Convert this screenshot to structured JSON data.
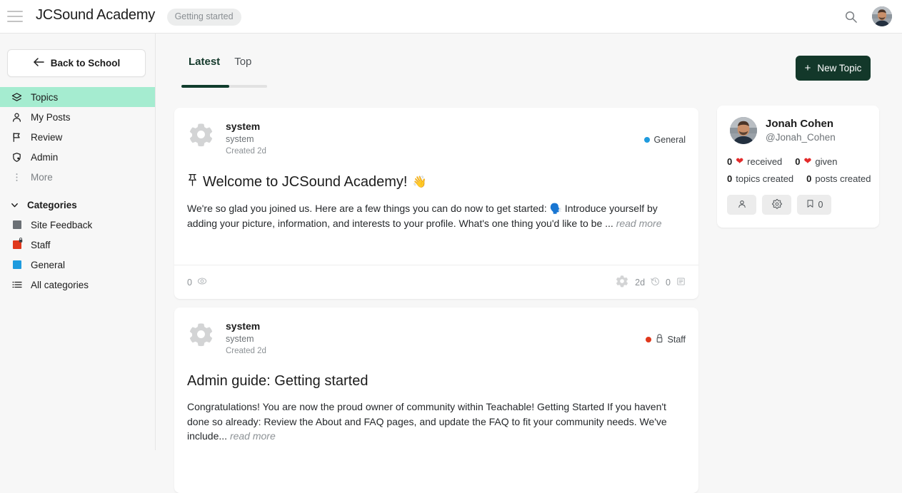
{
  "header": {
    "menu_icon": "hamburger-icon",
    "title": "JCSound Academy",
    "badge": "Getting started",
    "search_icon": "search-icon",
    "avatar_icon": "user-avatar"
  },
  "sidebar": {
    "back_button": "Back to School",
    "back_icon": "arrow-left-icon",
    "nav": [
      {
        "label": "Topics",
        "icon": "layers-icon",
        "active": true
      },
      {
        "label": "My Posts",
        "icon": "person-icon",
        "active": false
      },
      {
        "label": "Review",
        "icon": "flag-icon",
        "active": false
      },
      {
        "label": "Admin",
        "icon": "shield-icon",
        "active": false
      },
      {
        "label": "More",
        "icon": "dots-vertical-icon",
        "active": false
      }
    ],
    "categories_header": "Categories",
    "categories_chevron": "chevron-down-icon",
    "categories": [
      {
        "label": "Site Feedback",
        "color": "#6b7075",
        "locked": false
      },
      {
        "label": "Staff",
        "color": "#e0381c",
        "locked": true
      },
      {
        "label": "General",
        "color": "#1f9bde",
        "locked": false
      },
      {
        "label": "All categories",
        "color": "",
        "locked": false,
        "icon": "list-icon"
      }
    ]
  },
  "main": {
    "tabs": [
      {
        "label": "Latest",
        "active": true
      },
      {
        "label": "Top",
        "active": false
      }
    ],
    "new_topic_button": "New Topic",
    "new_topic_plus": "+",
    "topics": [
      {
        "author": "system",
        "author_sub": "system",
        "created": "Created 2d",
        "category": "General",
        "category_color": "#1f9bde",
        "locked": false,
        "pinned": true,
        "pin_icon": "pin-icon",
        "title": "Welcome to JCSound Academy!",
        "title_emoji": "👋",
        "excerpt": "We're so glad you joined us. Here are a few things you can do now to get started: 🗣️ Introduce yourself by adding your picture, information, and interests to your profile. What's one thing you'd like to be ...",
        "read_more": "read more",
        "views": "0",
        "views_icon": "eye-icon",
        "last_poster_icon": "gear-icon",
        "last_activity": "2d",
        "clock_icon": "clock-icon",
        "replies": "0",
        "replies_icon": "comment-icon"
      },
      {
        "author": "system",
        "author_sub": "system",
        "created": "Created 2d",
        "category": "Staff",
        "category_color": "#e0381c",
        "locked": true,
        "lock_icon": "lock-icon",
        "pinned": false,
        "title": "Admin guide: Getting started",
        "title_emoji": "",
        "excerpt": "Congratulations! You are now the proud owner of community within Teachable! Getting Started If you haven't done so already: Review the About and FAQ pages, and update the FAQ to fit your community needs. We've include...",
        "read_more": "read more"
      }
    ]
  },
  "profile": {
    "name": "Jonah Cohen",
    "handle": "@Jonah_Cohen",
    "avatar_icon": "user-avatar",
    "likes_received_count": "0",
    "likes_received_label": "received",
    "likes_given_count": "0",
    "likes_given_label": "given",
    "heart_icon": "heart-icon",
    "topics_count": "0",
    "topics_label": "topics created",
    "posts_count": "0",
    "posts_label": "posts created",
    "buttons": [
      {
        "name": "profile-button",
        "icon": "person-icon",
        "value": ""
      },
      {
        "name": "settings-button",
        "icon": "gear-icon",
        "value": ""
      },
      {
        "name": "bookmarks-button",
        "icon": "bookmark-icon",
        "value": "0"
      }
    ]
  },
  "colors": {
    "accent_dark_green": "#13382a",
    "active_nav_mint": "#a5ecd0",
    "page_bg": "#f7f7f7",
    "card_bg": "#ffffff"
  }
}
